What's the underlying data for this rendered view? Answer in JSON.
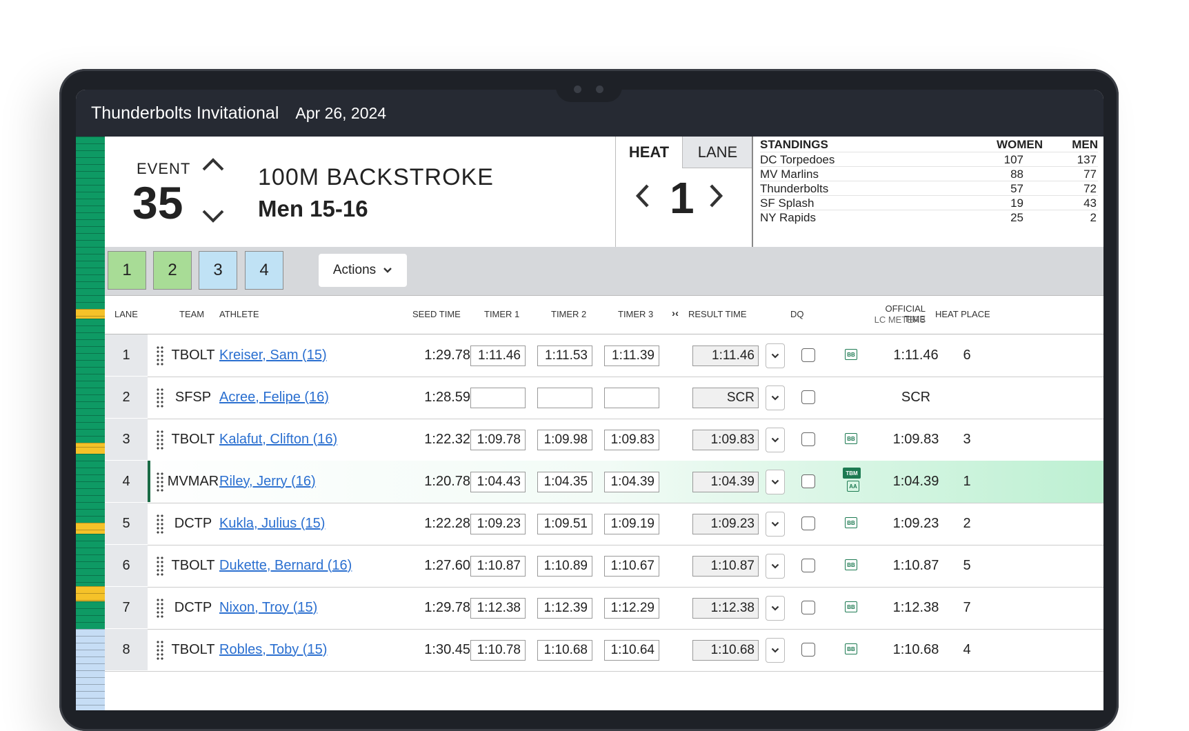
{
  "app": {
    "meet_name": "Thunderbolts Invitational",
    "meet_date": "Apr 26, 2024"
  },
  "event": {
    "label": "EVENT",
    "number": "35",
    "name": "100M BACKSTROKE",
    "group": "Men 15-16",
    "up_icon": "chevron-up-icon",
    "down_icon": "chevron-down-icon"
  },
  "heat_panel": {
    "tab_heat": "HEAT",
    "tab_lane": "LANE",
    "current": "1",
    "prev": "‹",
    "next": "›"
  },
  "standings": {
    "title": "STANDINGS",
    "women_label": "WOMEN",
    "men_label": "MEN",
    "rows": [
      {
        "team": "DC Torpedoes",
        "women": "107",
        "men": "137"
      },
      {
        "team": "MV Marlins",
        "women": "88",
        "men": "77"
      },
      {
        "team": "Thunderbolts",
        "women": "57",
        "men": "72"
      },
      {
        "team": "SF Splash",
        "women": "19",
        "men": "43"
      },
      {
        "team": "NY Rapids",
        "women": "25",
        "men": "2"
      }
    ]
  },
  "heat_buttons": [
    {
      "label": "1",
      "color": "#a8dc96"
    },
    {
      "label": "2",
      "color": "#a8dc96"
    },
    {
      "label": "3",
      "color": "#c0e2f5"
    },
    {
      "label": "4",
      "color": "#c0e2f5"
    }
  ],
  "actions": {
    "label": "Actions"
  },
  "columns": {
    "lane": "LANE",
    "team": "TEAM",
    "athlete": "ATHLETE",
    "seed": "SEED TIME",
    "timer1": "TIMER 1",
    "timer2": "TIMER 2",
    "timer3": "TIMER 3",
    "swap": "›‹",
    "result": "RESULT TIME",
    "dq": "DQ",
    "official": "OFFICIAL TIME",
    "official_sub": "LC METERS",
    "place": "HEAT PLACE"
  },
  "rows": [
    {
      "lane": "1",
      "team": "TBOLT",
      "athlete": "Kreiser, Sam (15)",
      "seed": "1:29.78",
      "t1": "1:11.46",
      "t2": "1:11.53",
      "t3": "1:11.39",
      "result": "1:11.46",
      "badge": "BB",
      "official": "1:11.46",
      "place": "6"
    },
    {
      "lane": "2",
      "team": "SFSP",
      "athlete": "Acree, Felipe (16)",
      "seed": "1:28.59",
      "t1": "",
      "t2": "",
      "t3": "",
      "result": "SCR",
      "badge": "",
      "official": "SCR",
      "place": ""
    },
    {
      "lane": "3",
      "team": "TBOLT",
      "athlete": "Kalafut, Clifton (16)",
      "seed": "1:22.32",
      "t1": "1:09.78",
      "t2": "1:09.98",
      "t3": "1:09.83",
      "result": "1:09.83",
      "badge": "BB",
      "official": "1:09.83",
      "place": "3"
    },
    {
      "lane": "4",
      "team": "MVMAR",
      "athlete": "Riley, Jerry (16)",
      "seed": "1:20.78",
      "t1": "1:04.43",
      "t2": "1:04.35",
      "t3": "1:04.39",
      "result": "1:04.39",
      "badge": "TBM",
      "badge_sub": "AA",
      "official": "1:04.39",
      "place": "1",
      "highlight": true
    },
    {
      "lane": "5",
      "team": "DCTP",
      "athlete": "Kukla, Julius (15)",
      "seed": "1:22.28",
      "t1": "1:09.23",
      "t2": "1:09.51",
      "t3": "1:09.19",
      "result": "1:09.23",
      "badge": "BB",
      "official": "1:09.23",
      "place": "2"
    },
    {
      "lane": "6",
      "team": "TBOLT",
      "athlete": "Dukette, Bernard (16)",
      "seed": "1:27.60",
      "t1": "1:10.87",
      "t2": "1:10.89",
      "t3": "1:10.67",
      "result": "1:10.87",
      "badge": "BB",
      "official": "1:10.87",
      "place": "5"
    },
    {
      "lane": "7",
      "team": "DCTP",
      "athlete": "Nixon, Troy (15)",
      "seed": "1:29.78",
      "t1": "1:12.38",
      "t2": "1:12.39",
      "t3": "1:12.29",
      "result": "1:12.38",
      "badge": "BB",
      "official": "1:12.38",
      "place": "7"
    },
    {
      "lane": "8",
      "team": "TBOLT",
      "athlete": "Robles, Toby (15)",
      "seed": "1:30.45",
      "t1": "1:10.78",
      "t2": "1:10.68",
      "t3": "1:10.64",
      "result": "1:10.68",
      "badge": "BB",
      "official": "1:10.68",
      "place": "4"
    }
  ],
  "colors": {
    "accent_green": "#1d7a52",
    "strip_green": "#0e9a64",
    "strip_yellow": "#f5c229",
    "strip_blue": "#c6ddf5",
    "link": "#2a6fd0"
  }
}
